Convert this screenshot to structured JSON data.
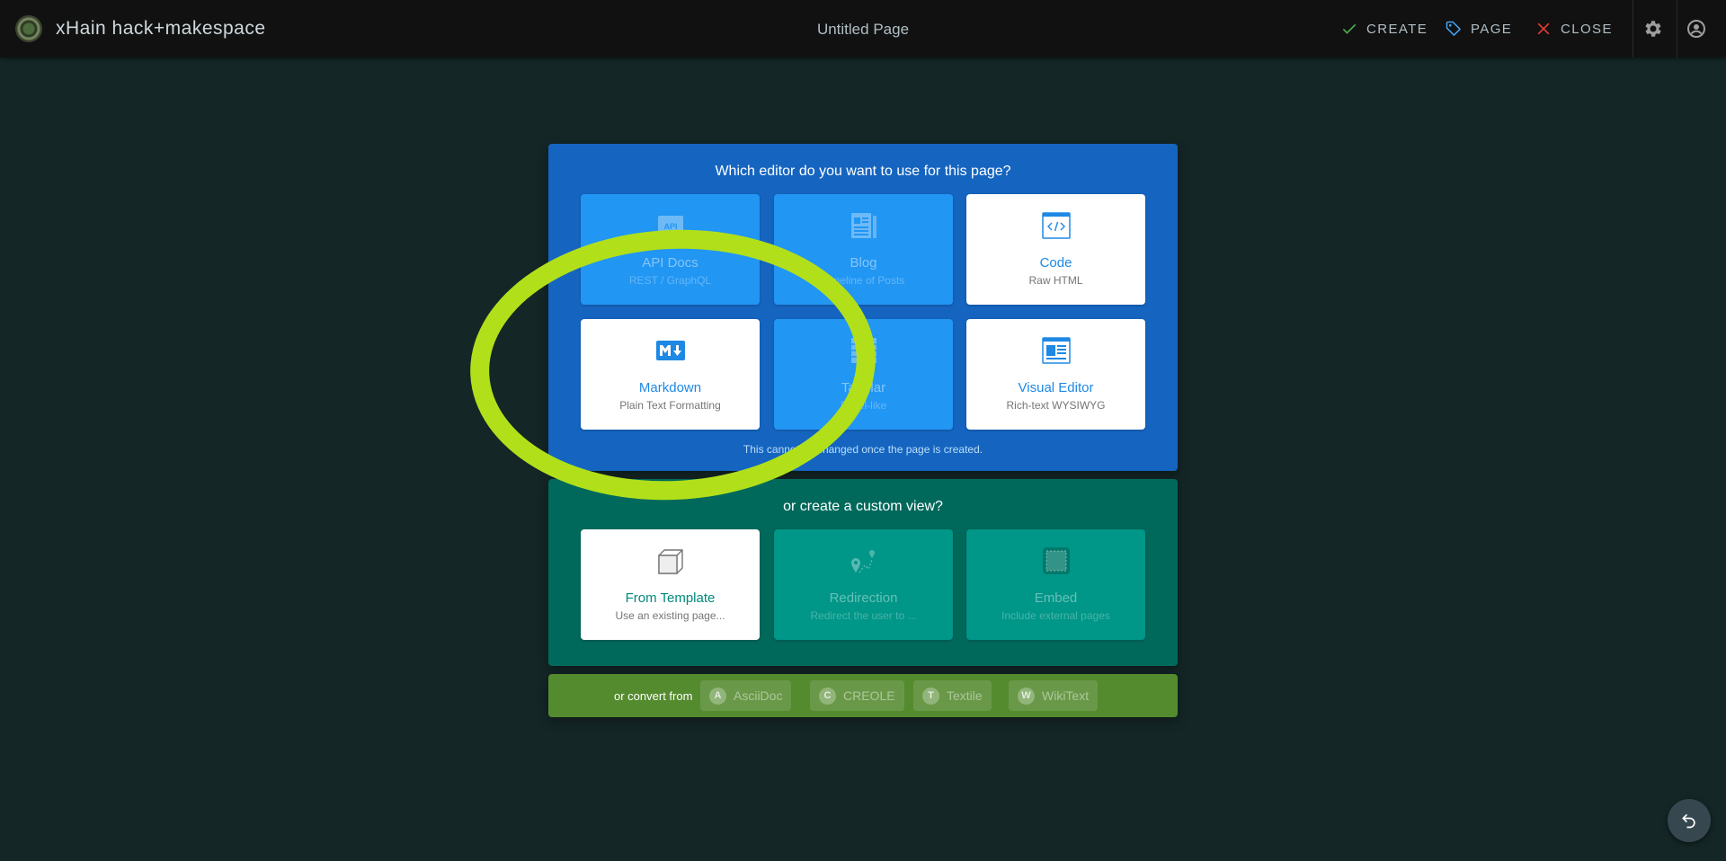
{
  "header": {
    "site_name": "xHain hack+makespace",
    "page_title": "Untitled Page",
    "create_label": "CREATE",
    "page_label": "PAGE",
    "close_label": "CLOSE"
  },
  "editor_panel": {
    "title": "Which editor do you want to use for this page?",
    "cards": [
      {
        "label": "API Docs",
        "sub": "REST / GraphQL",
        "icon": "api-icon",
        "enabled": false
      },
      {
        "label": "Blog",
        "sub": "Timeline of Posts",
        "icon": "blog-icon",
        "enabled": false
      },
      {
        "label": "Code",
        "sub": "Raw HTML",
        "icon": "code-icon",
        "enabled": true
      },
      {
        "label": "Markdown",
        "sub": "Plain Text Formatting",
        "icon": "markdown-icon",
        "enabled": true
      },
      {
        "label": "Tabular",
        "sub": "Excel-like",
        "icon": "table-icon",
        "enabled": false
      },
      {
        "label": "Visual Editor",
        "sub": "Rich-text WYSIWYG",
        "icon": "visual-editor-icon",
        "enabled": true
      }
    ],
    "note": "This cannot be changed once the page is created."
  },
  "custom_panel": {
    "title": "or create a custom view?",
    "cards": [
      {
        "label": "From Template",
        "sub": "Use an existing page...",
        "icon": "template-box-icon",
        "enabled": true
      },
      {
        "label": "Redirection",
        "sub": "Redirect the user to ...",
        "icon": "redirect-icon",
        "enabled": false
      },
      {
        "label": "Embed",
        "sub": "Include external pages",
        "icon": "embed-icon",
        "enabled": false
      }
    ]
  },
  "convert_panel": {
    "label": "or convert from",
    "chips": [
      {
        "avatar": "A",
        "label": "AsciiDoc"
      },
      {
        "avatar": "C",
        "label": "CREOLE"
      },
      {
        "avatar": "T",
        "label": "Textile"
      },
      {
        "avatar": "W",
        "label": "WikiText"
      }
    ]
  },
  "colors": {
    "accent_blue": "#1565c0",
    "accent_teal": "#00695c",
    "accent_green": "#558b2f",
    "highlight": "#b1e01a"
  }
}
